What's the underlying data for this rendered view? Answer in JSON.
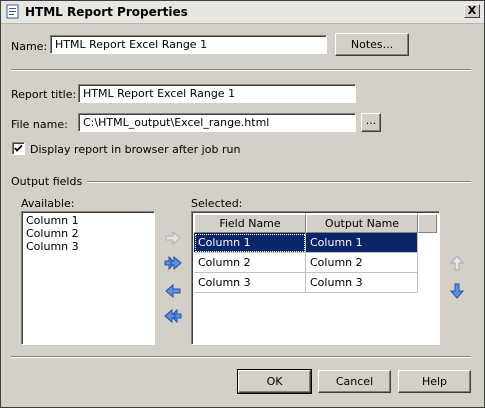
{
  "window": {
    "title": "HTML Report Properties",
    "close_label": "X"
  },
  "name_field": {
    "label": "Name:",
    "value": "HTML Report Excel Range 1"
  },
  "notes_button": {
    "label": "Notes..."
  },
  "report_title": {
    "label": "Report title:",
    "value": "HTML Report Excel Range 1"
  },
  "file_name": {
    "label": "File name:",
    "value": "C:\\HTML_output\\Excel_range.html",
    "browse_label": "..."
  },
  "display_checkbox": {
    "label": "Display report in browser after job run",
    "checked": true
  },
  "output_fields": {
    "group_label": "Output fields",
    "available_label": "Available:",
    "available_items": [
      "Column 1",
      "Column 2",
      "Column 3"
    ],
    "selected_label": "Selected:",
    "columns": [
      "Field Name",
      "Output Name"
    ],
    "rows": [
      [
        "Column 1",
        "Column 1"
      ],
      [
        "Column 2",
        "Column 2"
      ],
      [
        "Column 3",
        "Column 3"
      ]
    ],
    "selected_row": 0
  },
  "buttons": {
    "ok": "OK",
    "cancel": "Cancel",
    "help": "Help"
  },
  "colors": {
    "selection": "#0a246a",
    "dialog_bg": "#d4d0c8",
    "arrow_blue": "#3a6fd0"
  }
}
